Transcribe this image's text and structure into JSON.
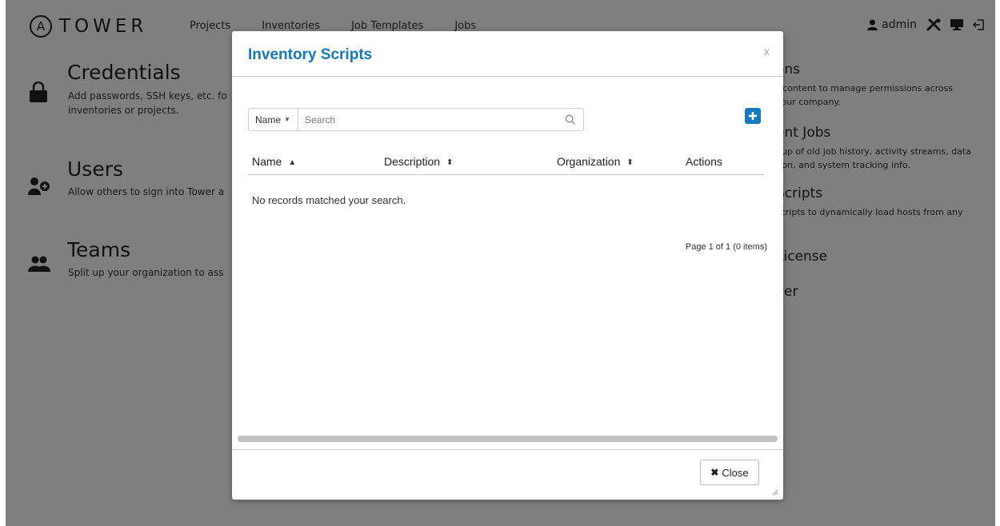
{
  "navbar": {
    "brand_logo": "A",
    "brand_name": "TOWER",
    "links": [
      "Projects",
      "Inventories",
      "Job Templates",
      "Jobs"
    ],
    "user": "admin",
    "icons": [
      "user-icon",
      "tools-icon",
      "monitor-icon",
      "logout-icon"
    ]
  },
  "background": {
    "credentials": {
      "title": "Credentials",
      "desc_line1": "Add passwords, SSH keys, etc. fo",
      "desc_line2": "inventories or projects."
    },
    "users": {
      "title": "Users",
      "desc": "Allow others to sign into Tower a"
    },
    "teams": {
      "title": "Teams",
      "desc": "Split up your organization to ass"
    },
    "right": {
      "organizations_title": "ons",
      "organizations_desc1": "r content to manage permissions across",
      "organizations_desc2": "your company.",
      "management_title": "ent Jobs",
      "management_desc1": "nup of old job history, activity streams, data",
      "management_desc2": "tion, and system tracking info.",
      "scripts_title": "Scripts",
      "scripts_desc": "scripts to dynamically load hosts from any",
      "license_title": "License",
      "about_title": "ver"
    }
  },
  "modal": {
    "title": "Inventory Scripts",
    "close_x": "x",
    "search": {
      "field": "Name",
      "placeholder": "Search"
    },
    "columns": [
      {
        "label": "Name",
        "sort": "asc"
      },
      {
        "label": "Description",
        "sort": "both"
      },
      {
        "label": "Organization",
        "sort": "both"
      },
      {
        "label": "Actions",
        "sort": "none"
      }
    ],
    "empty_message": "No records matched your search.",
    "pager": "Page 1 of 1 (0 items)",
    "close_button": "Close",
    "colors": {
      "accent": "#1778be"
    }
  }
}
